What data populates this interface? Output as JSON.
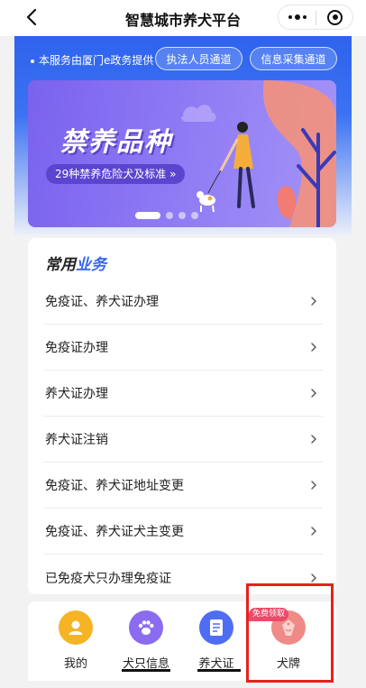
{
  "header": {
    "title": "智慧城市养犬平台",
    "back_icon": "chevron-left-icon",
    "more_icon": "more-dots-icon",
    "close_icon": "target-close-icon"
  },
  "hero": {
    "provider_text": "本服务由厦门e政务提供",
    "channel_buttons": [
      "执法人员通道",
      "信息采集通道"
    ]
  },
  "banner": {
    "title": "禁养品种",
    "subtitle": "29种禁养危险犬及标准 »",
    "slide_count": 4,
    "active_slide": 1
  },
  "services": {
    "heading_part1": "常用",
    "heading_part2": "业务",
    "items": [
      "免疫证、养犬证办理",
      "免疫证办理",
      "养犬证办理",
      "养犬证注销",
      "免疫证、养犬证地址变更",
      "免疫证、养犬证犬主变更",
      "已免疫犬只办理免疫证"
    ]
  },
  "nav": {
    "items": [
      {
        "label": "我的",
        "icon": "user-icon",
        "color": "#f6b324"
      },
      {
        "label": "犬只信息",
        "icon": "paw-icon",
        "color": "#8b6cf0"
      },
      {
        "label": "养犬证",
        "icon": "document-icon",
        "color": "#4f6df2"
      },
      {
        "label": "犬牌",
        "icon": "dog-tag-icon",
        "color": "#f08a86"
      }
    ],
    "free_badge": "免费领取"
  },
  "colors": {
    "primary_blue": "#2e63ec",
    "banner_purple": "#8d78f4",
    "highlight_red": "#e8201c"
  }
}
